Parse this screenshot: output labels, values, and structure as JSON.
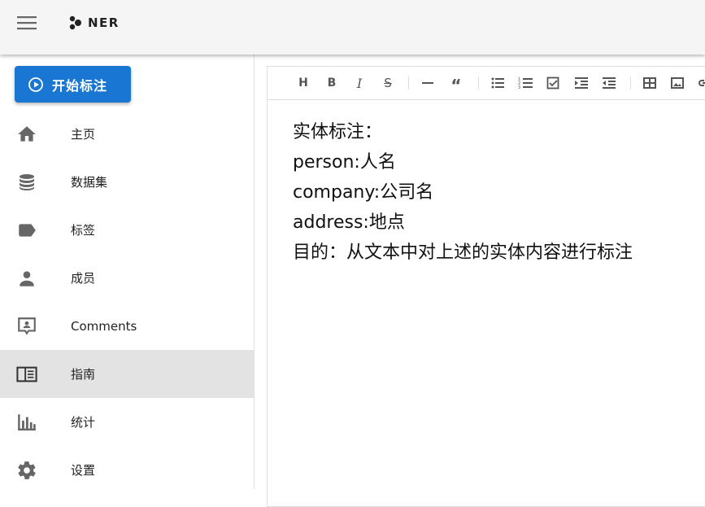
{
  "appbar": {
    "brand": "NER"
  },
  "sidebar": {
    "start_button": "开始标注",
    "items": [
      {
        "label": "主页",
        "icon": "home-icon"
      },
      {
        "label": "数据集",
        "icon": "database-icon"
      },
      {
        "label": "标签",
        "icon": "label-icon"
      },
      {
        "label": "成员",
        "icon": "person-icon"
      },
      {
        "label": "Comments",
        "icon": "comment-account-icon"
      },
      {
        "label": "指南",
        "icon": "book-open-icon",
        "active": true
      },
      {
        "label": "统计",
        "icon": "chart-bar-icon"
      },
      {
        "label": "设置",
        "icon": "gear-icon"
      }
    ]
  },
  "editor": {
    "toolbar": [
      "heading",
      "bold",
      "italic",
      "strikethrough",
      "horizontal-rule",
      "quote",
      "bullet-list",
      "ordered-list",
      "task-list",
      "indent",
      "outdent",
      "table",
      "image",
      "link"
    ],
    "lines": [
      "实体标注：",
      "person:人名",
      "company:公司名",
      "address:地点",
      "目的：从文本中对上述的实体内容进行标注"
    ]
  }
}
